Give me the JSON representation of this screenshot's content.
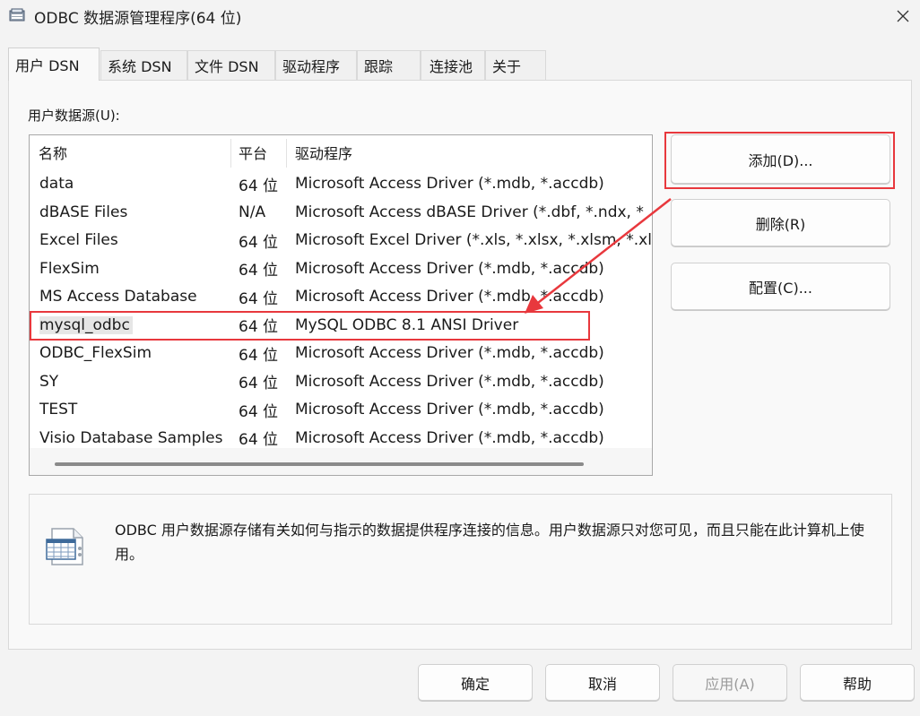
{
  "window": {
    "title": "ODBC 数据源管理程序(64 位)",
    "app_icon": "odbc-app-icon",
    "close_icon": "close-icon"
  },
  "tabs": [
    {
      "label": "用户 DSN",
      "active": true
    },
    {
      "label": "系统 DSN",
      "active": false
    },
    {
      "label": "文件 DSN",
      "active": false
    },
    {
      "label": "驱动程序",
      "active": false
    },
    {
      "label": "跟踪",
      "active": false
    },
    {
      "label": "连接池",
      "active": false
    },
    {
      "label": "关于",
      "active": false
    }
  ],
  "user_dsn": {
    "list_label": "用户数据源(U):",
    "columns": {
      "name": "名称",
      "platform": "平台",
      "driver": "驱动程序"
    },
    "rows": [
      {
        "name": "data",
        "platform": "64 位",
        "driver": "Microsoft Access Driver (*.mdb, *.accdb)"
      },
      {
        "name": "dBASE Files",
        "platform": "N/A",
        "driver": "Microsoft Access dBASE Driver (*.dbf, *.ndx, *"
      },
      {
        "name": "Excel Files",
        "platform": "64 位",
        "driver": "Microsoft Excel Driver (*.xls, *.xlsx, *.xlsm, *.xls"
      },
      {
        "name": "FlexSim",
        "platform": "64 位",
        "driver": "Microsoft Access Driver (*.mdb, *.accdb)"
      },
      {
        "name": "MS Access Database",
        "platform": "64 位",
        "driver": "Microsoft Access Driver (*.mdb, *.accdb)"
      },
      {
        "name": "mysql_odbc",
        "platform": "64 位",
        "driver": "MySQL ODBC 8.1 ANSI Driver",
        "selected": true
      },
      {
        "name": "ODBC_FlexSim",
        "platform": "64 位",
        "driver": "Microsoft Access Driver (*.mdb, *.accdb)"
      },
      {
        "name": "SY",
        "platform": "64 位",
        "driver": "Microsoft Access Driver (*.mdb, *.accdb)"
      },
      {
        "name": "TEST",
        "platform": "64 位",
        "driver": "Microsoft Access Driver (*.mdb, *.accdb)"
      },
      {
        "name": "Visio Database Samples",
        "platform": "64 位",
        "driver": "Microsoft Access Driver (*.mdb, *.accdb)"
      }
    ],
    "buttons": {
      "add": "添加(D)...",
      "remove": "删除(R)",
      "configure": "配置(C)..."
    },
    "description": "ODBC 用户数据源存储有关如何与指示的数据提供程序连接的信息。用户数据源只对您可见，而且只能在此计算机上使用。",
    "description_icon": "data-source-icon"
  },
  "footer": {
    "ok": "确定",
    "cancel": "取消",
    "apply": "应用(A)",
    "help": "帮助"
  },
  "annotations": {
    "highlight_color": "#e8383d"
  }
}
